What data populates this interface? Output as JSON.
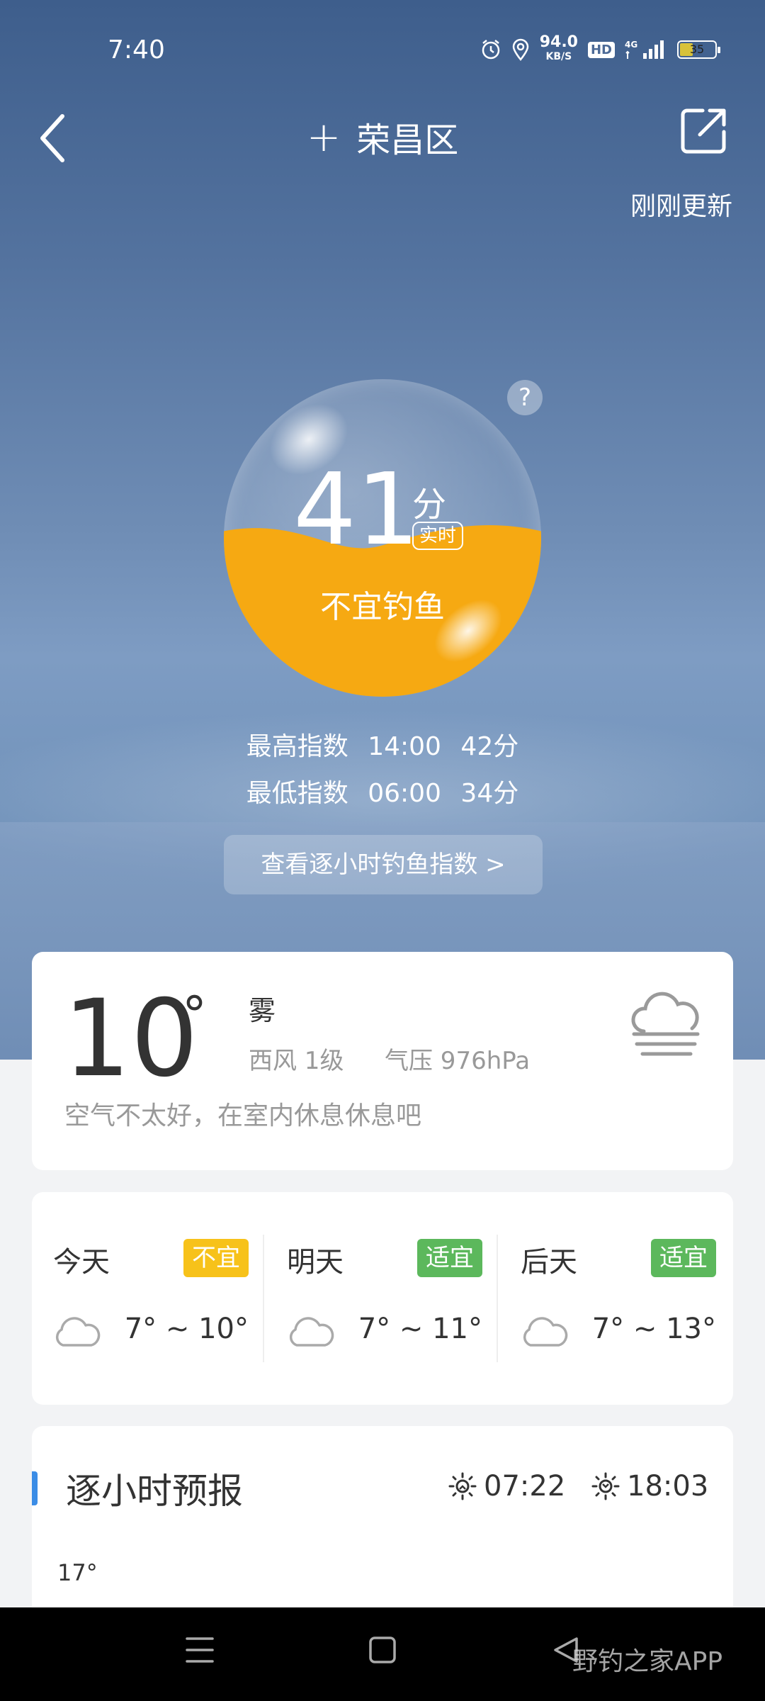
{
  "status_bar": {
    "time": "7:40",
    "net_speed": "94.0",
    "net_unit": "KB/S",
    "hd_label": "HD",
    "network": "4G",
    "battery": "35"
  },
  "header": {
    "location": "荣昌区",
    "updated": "刚刚更新"
  },
  "fishing_index": {
    "score": "41",
    "unit": "分",
    "realtime_label": "实时",
    "verdict": "不宜钓鱼",
    "level_fraction": 0.41,
    "highest": {
      "label": "最高指数",
      "time": "14:00",
      "score": "42分"
    },
    "lowest": {
      "label": "最低指数",
      "time": "06:00",
      "score": "34分"
    },
    "hourly_link": "查看逐小时钓鱼指数  >"
  },
  "current_weather": {
    "temp": "10",
    "deg_symbol": "°",
    "condition": "雾",
    "wind": "西风  1级",
    "pressure": "气压  976hPa",
    "advice": "空气不太好，在室内休息休息吧",
    "icon": "fog-icon"
  },
  "forecast": [
    {
      "day": "今天",
      "tag": "不宜",
      "tag_color": "#f7c21a",
      "range": "7° ~ 10°",
      "icon": "cloud-icon"
    },
    {
      "day": "明天",
      "tag": "适宜",
      "tag_color": "#5cb85c",
      "range": "7° ~ 11°",
      "icon": "cloud-icon"
    },
    {
      "day": "后天",
      "tag": "适宜",
      "tag_color": "#5cb85c",
      "range": "7° ~ 13°",
      "icon": "cloud-icon"
    }
  ],
  "hourly": {
    "title": "逐小时预报",
    "sunrise": "07:22",
    "sunset": "18:03",
    "first_temp": "17°"
  },
  "watermark": "野钓之家APP"
}
